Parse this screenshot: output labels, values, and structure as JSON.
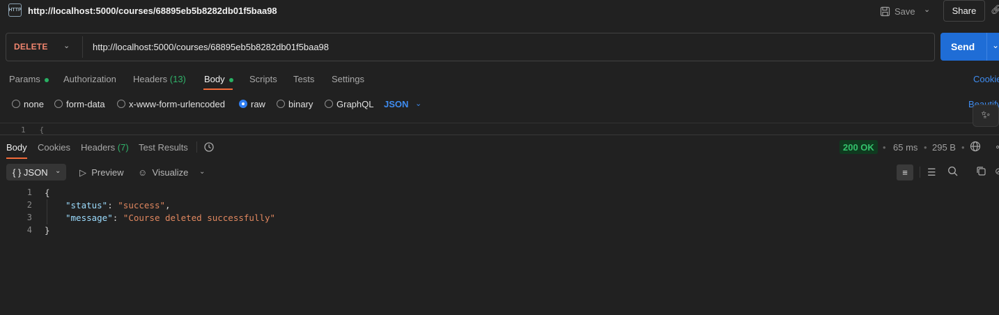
{
  "header": {
    "icon_text": "HTTP",
    "title": "http://localhost:5000/courses/68895eb5b8282db01f5baa98",
    "save_label": "Save",
    "share_label": "Share"
  },
  "request": {
    "method": "DELETE",
    "method_color": "#f2866f",
    "url": "http://localhost:5000/courses/68895eb5b8282db01f5baa98",
    "send_label": "Send",
    "send_color": "#1f6dd6"
  },
  "request_tabs": {
    "params": "Params",
    "authorization": "Authorization",
    "headers": "Headers",
    "headers_count": "(13)",
    "body": "Body",
    "scripts": "Scripts",
    "tests": "Tests",
    "settings": "Settings",
    "active": "Body",
    "cookies": "Cookies"
  },
  "body_options": {
    "none": "none",
    "form_data": "form-data",
    "urlencoded": "x-www-form-urlencoded",
    "raw": "raw",
    "binary": "binary",
    "graphql": "GraphQL",
    "selected": "raw",
    "format": "JSON",
    "beautify": "Beautify"
  },
  "editor": {
    "line_number": "1",
    "line_text": "{"
  },
  "response": {
    "tabs": {
      "body": "Body",
      "cookies": "Cookies",
      "headers": "Headers",
      "headers_count": "(7)",
      "test_results": "Test Results",
      "active": "Body"
    },
    "status": "200 OK",
    "status_color": "#34c26c",
    "time": "65 ms",
    "size": "295 B",
    "toolbar": {
      "format_icon": "{ }",
      "format": "JSON",
      "preview": "Preview",
      "visualize": "Visualize"
    },
    "lines": [
      {
        "n": "1",
        "open": "{"
      },
      {
        "n": "2",
        "key": "\"status\"",
        "sep": ": ",
        "value": "\"success\"",
        "end": ","
      },
      {
        "n": "3",
        "key": "\"message\"",
        "sep": ": ",
        "value": "\"Course deleted successfully\"",
        "end": ""
      },
      {
        "n": "4",
        "close": "}"
      }
    ]
  }
}
